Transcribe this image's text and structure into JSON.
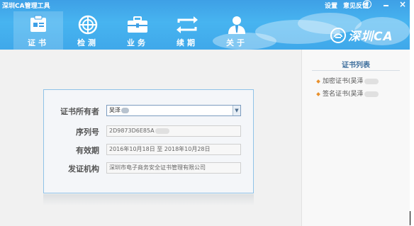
{
  "app": {
    "title": "深圳CA管理工具",
    "links": [
      "设置",
      "意见反馈"
    ],
    "help": "?",
    "close": "×",
    "brand": "深圳CA"
  },
  "nav": [
    {
      "label": "证书",
      "icon": "certificate-icon",
      "active": true
    },
    {
      "label": "检测",
      "icon": "detect-globe-icon",
      "active": false
    },
    {
      "label": "业务",
      "icon": "briefcase-icon",
      "active": false
    },
    {
      "label": "续期",
      "icon": "renew-arrows-icon",
      "active": false
    },
    {
      "label": "关于",
      "icon": "about-user-icon",
      "active": false
    }
  ],
  "form": {
    "owner_label": "证书所有者",
    "owner_value": "吴泽",
    "serial_label": "序列号",
    "serial_value": "2D9873D6E85A",
    "validity_label": "有效期",
    "validity_value": "2016年10月18日 至 2018年10月28日",
    "issuer_label": "发证机构",
    "issuer_value": "深圳市电子商务安全证书管理有限公司"
  },
  "side": {
    "title": "证书列表",
    "items": [
      "加密证书(吴泽",
      "签名证书(吴泽"
    ]
  },
  "colors": {
    "header": "#47b4f0",
    "panel_border": "#8fc2e8",
    "side_title": "#3d6e9c",
    "bullet": "#e9912d"
  }
}
